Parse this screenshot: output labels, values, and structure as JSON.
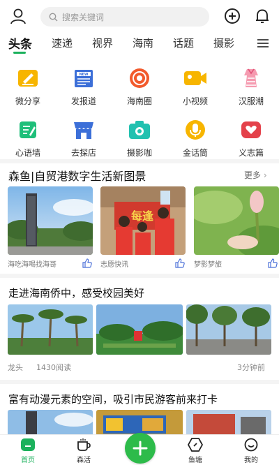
{
  "search": {
    "placeholder": "搜索关键词"
  },
  "tabs": [
    "头条",
    "速递",
    "视界",
    "海南",
    "话题",
    "摄影"
  ],
  "shortcuts": [
    {
      "label": "微分享",
      "icon": "edit-icon",
      "color": "#f5b400"
    },
    {
      "label": "发报道",
      "icon": "news-icon",
      "color": "#3c6fd8"
    },
    {
      "label": "海南圈",
      "icon": "broadcast-icon",
      "color": "#f25a2c"
    },
    {
      "label": "小视频",
      "icon": "video-camera-icon",
      "color": "#f5b400"
    },
    {
      "label": "汉服潮",
      "icon": "dress-icon",
      "color": "#f06a8a"
    },
    {
      "label": "心语墙",
      "icon": "note-icon",
      "color": "#1fbf7a"
    },
    {
      "label": "去探店",
      "icon": "shop-icon",
      "color": "#3c6fd8"
    },
    {
      "label": "摄影咖",
      "icon": "camera-icon",
      "color": "#22c1b0"
    },
    {
      "label": "金话筒",
      "icon": "microphone-icon",
      "color": "#f5b400"
    },
    {
      "label": "义志篇",
      "icon": "heart-hand-icon",
      "color": "#e4414a"
    }
  ],
  "featured": {
    "title": "森鱼|自贸港数字生活新图景",
    "more": "更多",
    "cards": [
      {
        "caption": "海吃海喝找海哥"
      },
      {
        "caption": "志愿快讯"
      },
      {
        "caption": "梦影梦旅"
      }
    ]
  },
  "article1": {
    "title": "走进海南侨中，感受校园美好",
    "source": "龙头",
    "reads": "1430阅读",
    "time": "3分钟前"
  },
  "article2": {
    "title": "富有动漫元素的空间，吸引市民游客前来打卡"
  },
  "nav": [
    {
      "label": "首页",
      "icon": "home-icon"
    },
    {
      "label": "森活",
      "icon": "coffee-cup-icon"
    },
    {
      "label": "鱼塘",
      "icon": "hexagon-icon"
    },
    {
      "label": "我的",
      "icon": "smile-icon"
    }
  ],
  "colors": {
    "accent": "#1bb15c",
    "plus": "#2dbb4a"
  }
}
